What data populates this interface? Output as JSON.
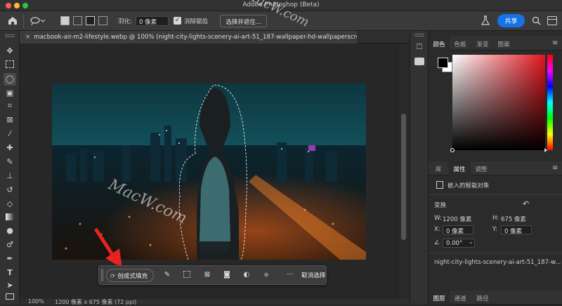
{
  "window": {
    "title": "Adobe Photoshop (Beta)"
  },
  "options": {
    "feather_label": "羽化:",
    "feather_value": "0 像素",
    "antialias_label": "消除锯齿",
    "select_mask_label": "选择并遮住...",
    "share_label": "共享"
  },
  "document": {
    "tab_title": "macbook-air-m2-lifestyle.webp @ 100% (night-city-lights-scenery-ai-art-51_187-wallpaper-hd-wallpaperscre..."
  },
  "context_bar": {
    "generative_fill_label": "创成式填充",
    "deselect_label": "取消选择",
    "more_label": "···"
  },
  "status": {
    "zoom": "100%",
    "doc_info": "1200 像素 x 675 像素 (72 ppi)"
  },
  "color_panel": {
    "tabs": [
      "颜色",
      "色板",
      "渐变",
      "图案"
    ],
    "active": "颜色",
    "foreground": "#000000",
    "background": "#ffffff"
  },
  "properties_panel": {
    "tabs": [
      "库",
      "属性",
      "调整"
    ],
    "active": "属性",
    "type_label": "嵌入的智能对象",
    "transform_label": "变换",
    "w_label": "W:",
    "w_value": "1200 像素",
    "h_label": "H:",
    "h_value": "675 像素",
    "x_label": "X:",
    "x_value": "0 像素",
    "y_label": "Y:",
    "y_value": "0 像素",
    "angle_value": "0.00°",
    "filename": "night-city-lights-scenery-ai-art-51_187-w..."
  },
  "layers_panel": {
    "tabs": [
      "图层",
      "通道",
      "路径"
    ],
    "active": "图层"
  },
  "watermark": {
    "text": "MacW.com"
  },
  "colors": {
    "accent": "#1473e6",
    "panel": "#2b2b2b",
    "toolbar": "#323232"
  }
}
